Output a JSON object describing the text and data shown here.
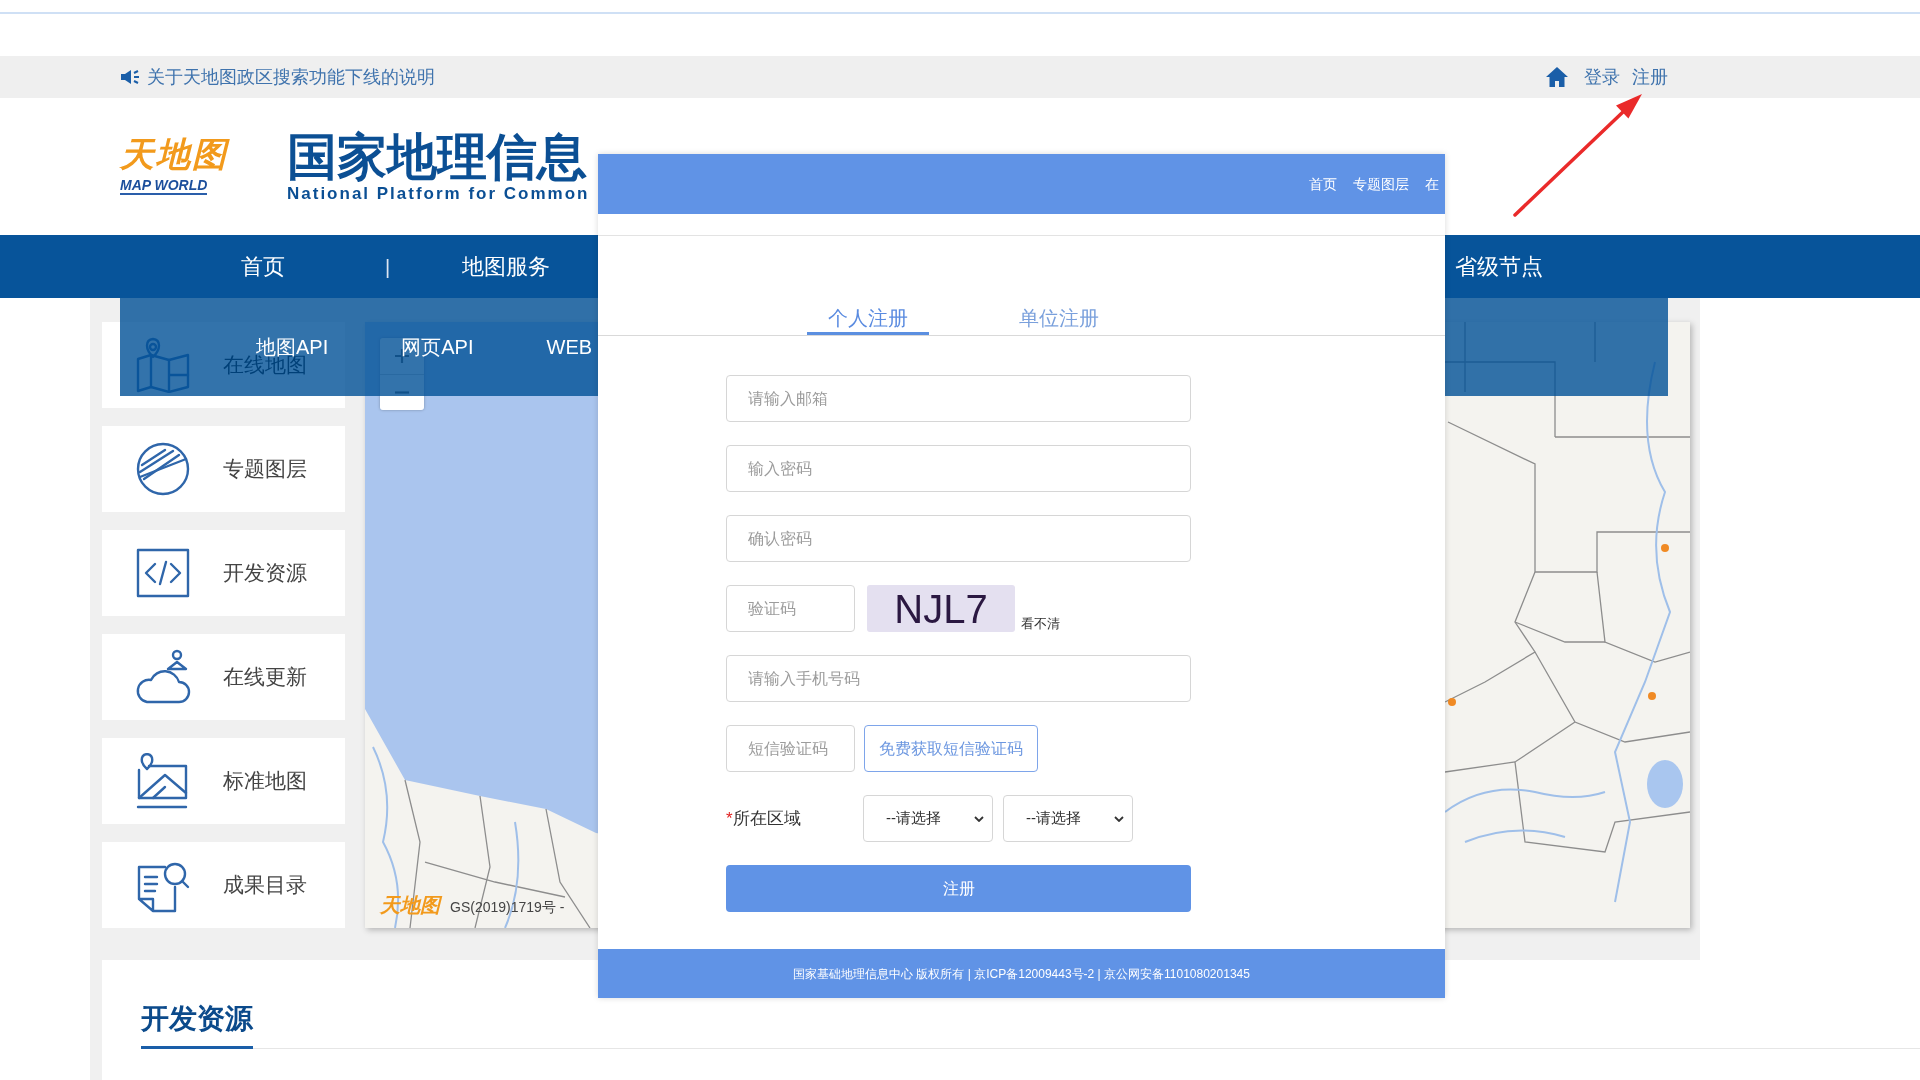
{
  "notice_bar": {
    "notice": "关于天地图政区搜索功能下线的说明",
    "links": [
      "登录",
      "注册"
    ]
  },
  "header": {
    "logo_text": "天地图",
    "logo_wordmark": "MAP WORLD",
    "title": "国家地理信息",
    "subtitle": "National Platform for Common"
  },
  "nav": [
    {
      "kind": "link",
      "label": "首页"
    },
    {
      "kind": "separator",
      "label": "|"
    },
    {
      "kind": "link",
      "label": "地图服务"
    },
    {
      "kind": "link",
      "label": "省级节点"
    }
  ],
  "submenu": [
    "地图API",
    "网页API",
    "WEB"
  ],
  "sidebar": [
    "在线地图",
    "专题图层",
    "开发资源",
    "在线更新",
    "标准地图",
    "成果目录"
  ],
  "map": {
    "logo": "天地图",
    "attribution": "GS(2019)1719号 -"
  },
  "modal": {
    "header_links": [
      "首页",
      "专题图层",
      "在"
    ],
    "tabs": [
      {
        "label": "个人注册",
        "selected": true
      },
      {
        "label": "单位注册",
        "selected": false
      }
    ],
    "fields": [
      {
        "kind": "input",
        "placeholder": "请输入邮箱"
      },
      {
        "kind": "input",
        "placeholder": "输入密码"
      },
      {
        "kind": "input",
        "placeholder": "确认密码"
      },
      {
        "kind": "captcha",
        "placeholder": "验证码",
        "code": "NJL7",
        "refresh": "看不清"
      },
      {
        "kind": "input",
        "placeholder": "请输入手机号码"
      },
      {
        "kind": "sms",
        "placeholder": "短信验证码",
        "button": "免费获取短信验证码"
      },
      {
        "kind": "region",
        "required_mark": "*",
        "label": "所在区域",
        "selects": [
          "--请选择",
          "--请选择"
        ]
      }
    ],
    "submit": "注册",
    "footer": "国家基础地理信息中心 版权所有 | 京ICP备12009443号-2 | 京公网安备1101080201345"
  },
  "section": {
    "title": "开发资源"
  }
}
